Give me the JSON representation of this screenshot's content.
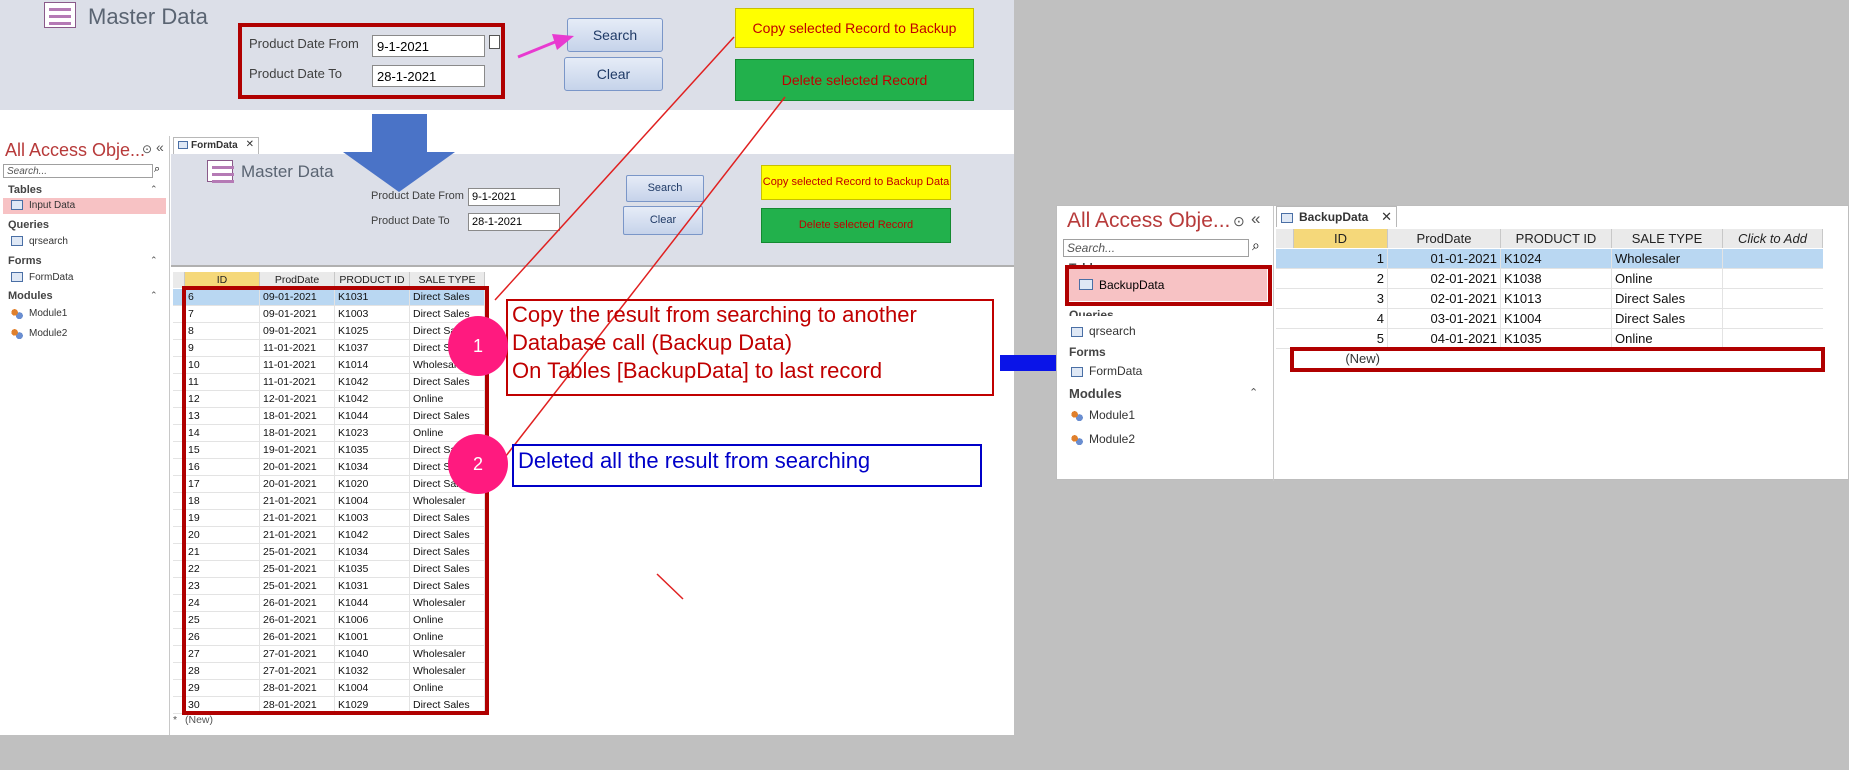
{
  "top_form": {
    "title": "Master Data",
    "date_from_label": "Product Date From",
    "date_from_value": "9-1-2021",
    "date_to_label": "Product Date To",
    "date_to_value": "28-1-2021",
    "search_label": "Search",
    "clear_label": "Clear",
    "copy_label": "Copy selected Record to Backup Data",
    "delete_label": "Delete selected Record"
  },
  "nav_left": {
    "title": "All Access Obje...",
    "search_placeholder": "Search...",
    "groups": [
      {
        "name": "Tables",
        "items": [
          "Input Data"
        ]
      },
      {
        "name": "Queries",
        "items": [
          "qrsearch"
        ]
      },
      {
        "name": "Forms",
        "items": [
          "FormData"
        ]
      },
      {
        "name": "Modules",
        "items": [
          "Module1",
          "Module2"
        ]
      }
    ]
  },
  "form_tab": {
    "label": "FormData"
  },
  "inner_form": {
    "title": "Master Data",
    "date_from_label": "Product Date From",
    "date_from_value": "9-1-2021",
    "date_to_label": "Product Date To",
    "date_to_value": "28-1-2021",
    "search_label": "Search",
    "clear_label": "Clear",
    "copy_label": "Copy selected Record to Backup Data",
    "delete_label": "Delete selected Record"
  },
  "datasheet": {
    "columns": [
      "ID",
      "ProdDate",
      "PRODUCT ID",
      "SALE TYPE"
    ],
    "rows": [
      [
        "6",
        "09-01-2021",
        "K1031",
        "Direct Sales"
      ],
      [
        "7",
        "09-01-2021",
        "K1003",
        "Direct Sales"
      ],
      [
        "8",
        "09-01-2021",
        "K1025",
        "Direct Sales"
      ],
      [
        "9",
        "11-01-2021",
        "K1037",
        "Direct Sales"
      ],
      [
        "10",
        "11-01-2021",
        "K1014",
        "Wholesaler"
      ],
      [
        "11",
        "11-01-2021",
        "K1042",
        "Direct Sales"
      ],
      [
        "12",
        "12-01-2021",
        "K1042",
        "Online"
      ],
      [
        "13",
        "18-01-2021",
        "K1044",
        "Direct Sales"
      ],
      [
        "14",
        "18-01-2021",
        "K1023",
        "Online"
      ],
      [
        "15",
        "19-01-2021",
        "K1035",
        "Direct Sales"
      ],
      [
        "16",
        "20-01-2021",
        "K1034",
        "Direct Sales"
      ],
      [
        "17",
        "20-01-2021",
        "K1020",
        "Direct Sales"
      ],
      [
        "18",
        "21-01-2021",
        "K1004",
        "Wholesaler"
      ],
      [
        "19",
        "21-01-2021",
        "K1003",
        "Direct Sales"
      ],
      [
        "20",
        "21-01-2021",
        "K1042",
        "Direct Sales"
      ],
      [
        "21",
        "25-01-2021",
        "K1034",
        "Direct Sales"
      ],
      [
        "22",
        "25-01-2021",
        "K1035",
        "Direct Sales"
      ],
      [
        "23",
        "25-01-2021",
        "K1031",
        "Direct Sales"
      ],
      [
        "24",
        "26-01-2021",
        "K1044",
        "Wholesaler"
      ],
      [
        "25",
        "26-01-2021",
        "K1006",
        "Online"
      ],
      [
        "26",
        "26-01-2021",
        "K1001",
        "Online"
      ],
      [
        "27",
        "27-01-2021",
        "K1040",
        "Wholesaler"
      ],
      [
        "28",
        "27-01-2021",
        "K1032",
        "Wholesaler"
      ],
      [
        "29",
        "28-01-2021",
        "K1004",
        "Online"
      ],
      [
        "30",
        "28-01-2021",
        "K1029",
        "Direct Sales"
      ]
    ],
    "new_label": "(New)"
  },
  "annotations": {
    "step1_number": "1",
    "step1_lines": [
      "Copy the result from searching to another",
      "Database call (Backup Data)",
      "On Tables [BackupData] to last record"
    ],
    "step2_number": "2",
    "step2_text": "Deleted all the result from searching"
  },
  "nav_right": {
    "title": "All Access Obje...",
    "search_placeholder": "Search...",
    "groups": [
      {
        "name": "Tables",
        "items": [
          "BackupData"
        ]
      },
      {
        "name": "Queries",
        "items": [
          "qrsearch"
        ]
      },
      {
        "name": "Forms",
        "items": [
          "FormData"
        ]
      },
      {
        "name": "Modules",
        "items": [
          "Module1",
          "Module2"
        ]
      }
    ]
  },
  "backup_tab": {
    "label": "BackupData"
  },
  "backup_sheet": {
    "columns": [
      "ID",
      "ProdDate",
      "PRODUCT ID",
      "SALE TYPE",
      "Click to Add"
    ],
    "rows": [
      [
        "1",
        "01-01-2021",
        "K1024",
        "Wholesaler"
      ],
      [
        "2",
        "02-01-2021",
        "K1038",
        "Online"
      ],
      [
        "3",
        "02-01-2021",
        "K1013",
        "Direct Sales"
      ],
      [
        "4",
        "03-01-2021",
        "K1004",
        "Direct Sales"
      ],
      [
        "5",
        "04-01-2021",
        "K1035",
        "Online"
      ]
    ],
    "new_label": "(New)"
  },
  "colors": {
    "accent_red": "#c00000",
    "arrow_blue": "#0000ff",
    "circle_pink": "#ff1a7f"
  }
}
